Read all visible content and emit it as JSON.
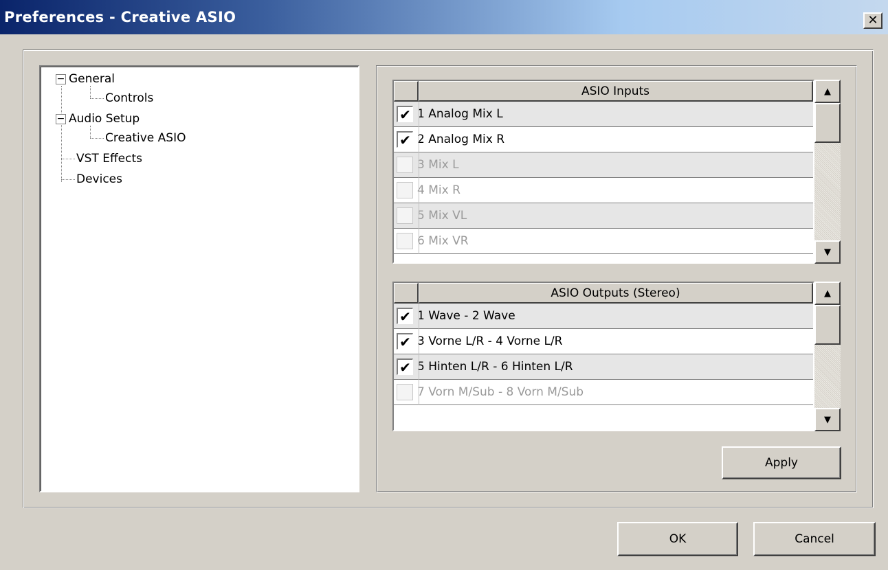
{
  "window": {
    "title": "Preferences - Creative ASIO",
    "close_glyph": "✕"
  },
  "tree": {
    "expander_glyph": "−",
    "items": [
      {
        "label": "General"
      },
      {
        "label": "Controls"
      },
      {
        "label": "Audio Setup"
      },
      {
        "label": "Creative ASIO"
      },
      {
        "label": "VST Effects"
      },
      {
        "label": "Devices"
      }
    ]
  },
  "inputs": {
    "header": "ASIO Inputs",
    "rows": [
      {
        "label": "1 Analog Mix L",
        "checked": true
      },
      {
        "label": "2 Analog Mix R",
        "checked": true
      },
      {
        "label": "3 Mix L",
        "checked": false
      },
      {
        "label": "4 Mix R",
        "checked": false
      },
      {
        "label": "5 Mix VL",
        "checked": false
      },
      {
        "label": "6 Mix VR",
        "checked": false
      }
    ]
  },
  "outputs": {
    "header": "ASIO Outputs (Stereo)",
    "rows": [
      {
        "label": "1 Wave - 2 Wave",
        "checked": true
      },
      {
        "label": "3 Vorne L/R - 4 Vorne L/R",
        "checked": true
      },
      {
        "label": "5 Hinten L/R - 6 Hinten L/R",
        "checked": true
      },
      {
        "label": "7 Vorn M/Sub - 8 Vorn M/Sub",
        "checked": false
      }
    ]
  },
  "checkmark_glyph": "✔",
  "scroll": {
    "up_glyph": "▲",
    "down_glyph": "▼"
  },
  "buttons": {
    "apply": "Apply",
    "ok": "OK",
    "cancel": "Cancel"
  }
}
